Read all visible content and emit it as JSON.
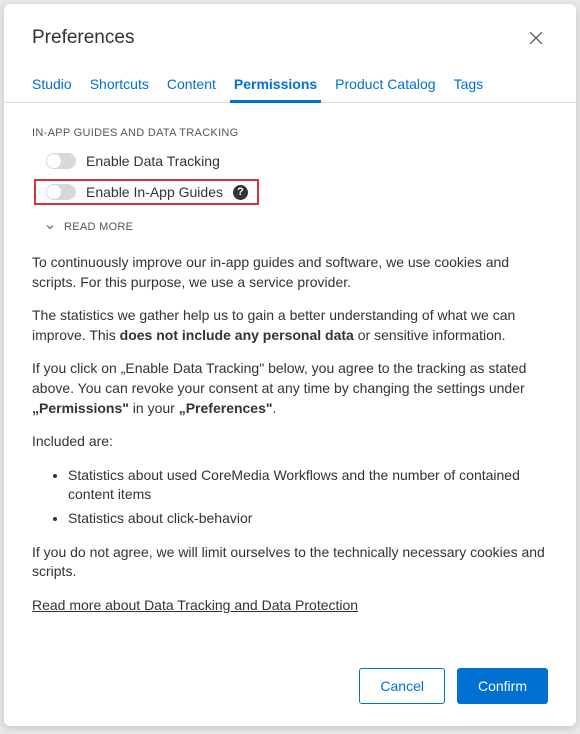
{
  "dialog": {
    "title": "Preferences"
  },
  "tabs": [
    {
      "label": "Studio"
    },
    {
      "label": "Shortcuts"
    },
    {
      "label": "Content"
    },
    {
      "label": "Permissions",
      "active": true
    },
    {
      "label": "Product Catalog"
    },
    {
      "label": "Tags"
    }
  ],
  "section": {
    "title": "IN-APP GUIDES AND DATA TRACKING"
  },
  "toggles": {
    "dataTracking": {
      "label": "Enable Data Tracking"
    },
    "inAppGuides": {
      "label": "Enable In-App Guides"
    }
  },
  "readMore": {
    "label": "READ MORE"
  },
  "body": {
    "p1": "To continuously improve our in-app guides and software, we use cookies and scripts. For this purpose, we use a service provider.",
    "p2a": "The statistics we gather help us to gain a better understanding of what we can improve. This ",
    "p2b": "does not include any personal data",
    "p2c": " or sensitive information.",
    "p3a": "If you click on „Enable Data Tracking\" below, you agree to the tracking as stated above. You can revoke your consent at any time by changing the settings under ",
    "p3b": "„Permissions\"",
    "p3c": " in your ",
    "p3d": "„Preferences\"",
    "p3e": ".",
    "p4": "Included are:",
    "li1": "Statistics about used CoreMedia Workflows and the number of contained content items",
    "li2": "Statistics about click-behavior",
    "p5": "If you do not agree, we will limit ourselves to the technically necessary cookies and scripts.",
    "link": "Read more about Data Tracking and Data Protection"
  },
  "footer": {
    "cancel": "Cancel",
    "confirm": "Confirm"
  }
}
